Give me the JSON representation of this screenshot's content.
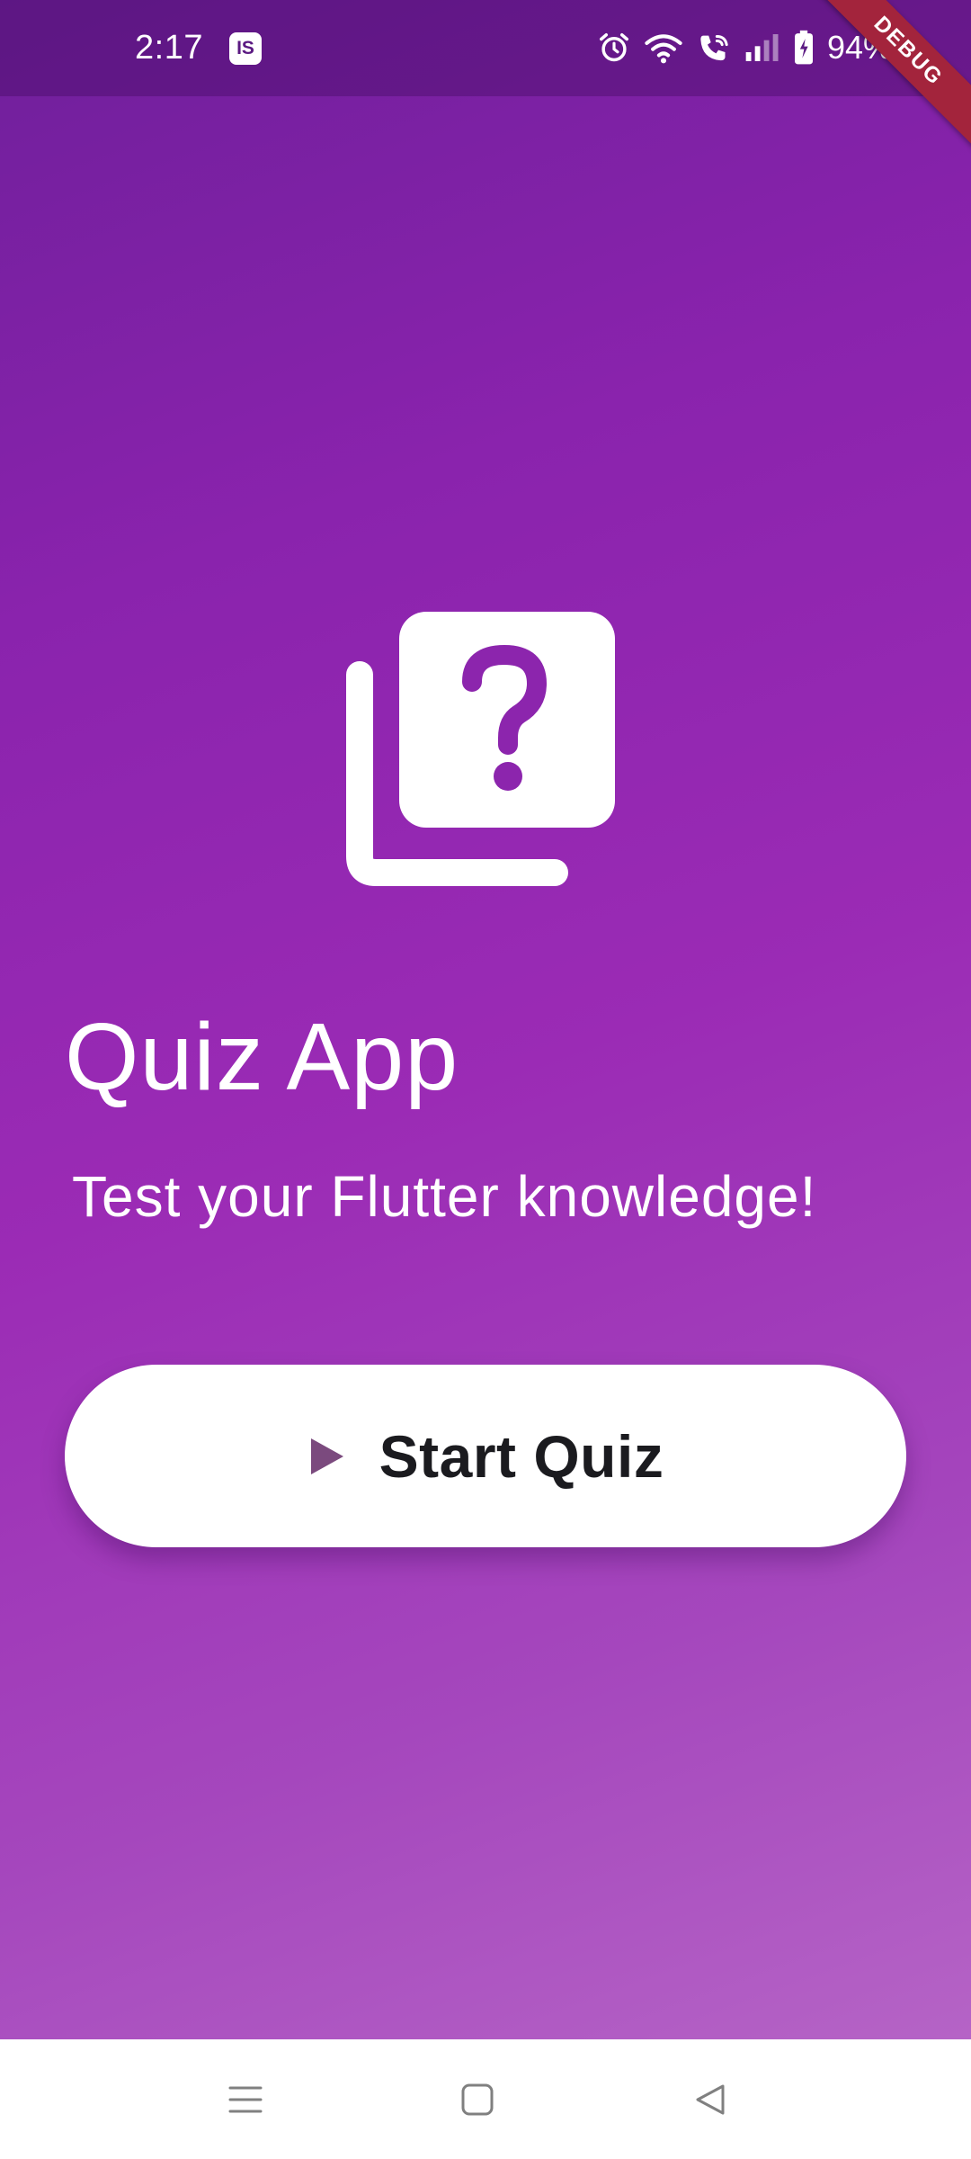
{
  "status_bar": {
    "time": "2:17",
    "notification_badge": "IS",
    "battery_percent": "94%",
    "icons": [
      "alarm-icon",
      "wifi-icon",
      "wifi-call-icon",
      "signal-icon",
      "battery-charging-icon"
    ]
  },
  "debug_banner": "DEBUG",
  "main": {
    "logo_icon": "quiz-icon",
    "title": "Quiz App",
    "subtitle": "Test your Flutter knowledge!",
    "start_button": {
      "label": "Start Quiz",
      "icon": "play-icon"
    }
  },
  "nav_bar": {
    "buttons": [
      "menu-icon",
      "home-icon",
      "back-icon"
    ]
  },
  "colors": {
    "gradient_start": "#6f1f9b",
    "gradient_end": "#b96ac8",
    "button_background": "#ffffff",
    "button_text": "#1b1b1f",
    "play_icon": "#7b4a7e",
    "debug_banner": "#a3243c"
  }
}
